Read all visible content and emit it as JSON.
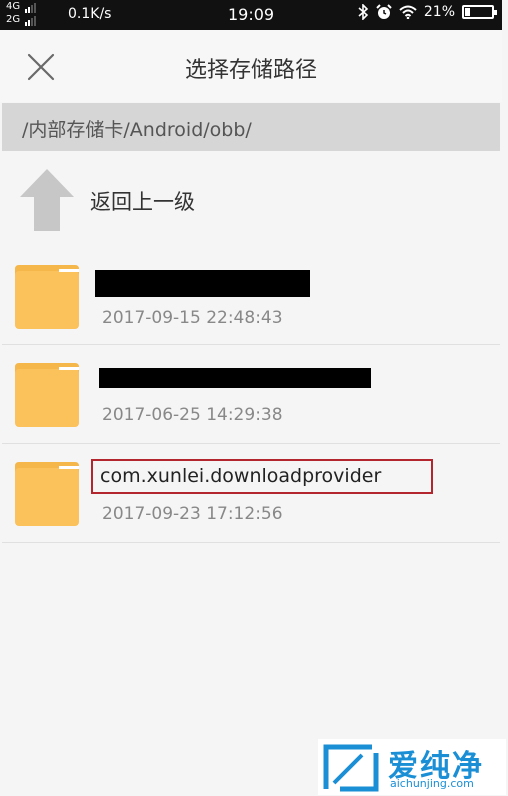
{
  "status_bar": {
    "net_top": "4G",
    "net_bottom": "2G",
    "speed": "0.1K/s",
    "time": "19:09",
    "battery_percent": "21%",
    "battery_level": 0.21,
    "icons": [
      "bluetooth-icon",
      "alarm-icon",
      "wifi-icon",
      "battery-icon"
    ]
  },
  "header": {
    "title": "选择存储路径",
    "close_icon": "close-icon"
  },
  "path": "/内部存储卡/Android/obb/",
  "up_item": {
    "label": "返回上一级",
    "icon": "up-arrow-icon"
  },
  "folders": [
    {
      "name": "",
      "redacted": true,
      "date": "2017-09-15 22:48:43"
    },
    {
      "name": "",
      "redacted": true,
      "date": "2017-06-25 14:29:38"
    },
    {
      "name": "com.xunlei.downloadprovider",
      "redacted": false,
      "highlighted": true,
      "date": "2017-09-23 17:12:56"
    }
  ],
  "watermark": {
    "text": "爱纯净",
    "url": "aichunjing.com"
  },
  "colors": {
    "folder": "#fbc15b",
    "folder_tab": "#f5b64a",
    "highlight": "#b3262d",
    "watermark": "#1a8fd6"
  }
}
